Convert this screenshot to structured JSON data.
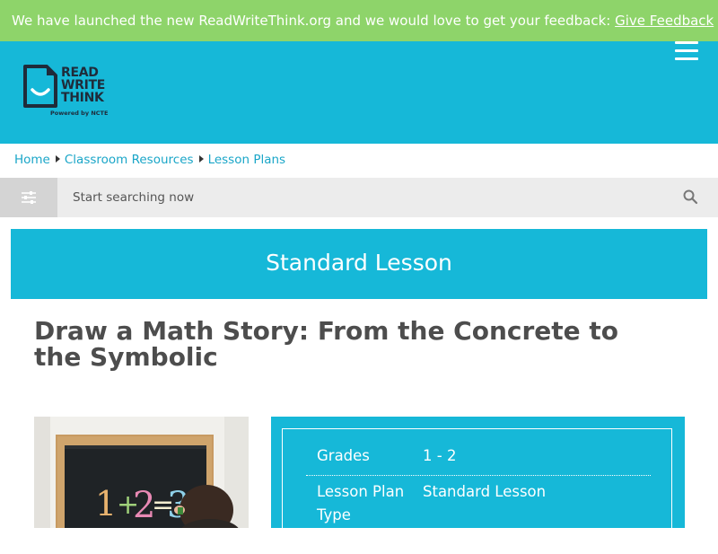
{
  "banner": {
    "message": "We have launched the new ReadWriteThink.org and we would love to get your feedback:",
    "link_label": "Give Feedback"
  },
  "header": {
    "logo": {
      "line1": "READ",
      "line2": "WRITE",
      "line3": "THINK",
      "powered_by": "Powered by NCTE"
    },
    "menu_icon": "hamburger-icon"
  },
  "breadcrumb": [
    "Home",
    "Classroom Resources",
    "Lesson Plans"
  ],
  "search": {
    "placeholder": "Start searching now",
    "filter_icon": "sliders-icon",
    "search_icon": "magnifier-icon"
  },
  "lesson": {
    "type_label": "Standard Lesson",
    "title": "Draw a Math Story: From the Concrete to the Symbolic",
    "image_text": "1+2=3",
    "info": [
      {
        "label": "Grades",
        "value": "1 - 2"
      },
      {
        "label": "Lesson Plan Type",
        "value": "Standard Lesson"
      }
    ]
  },
  "colors": {
    "banner": "#8ed46a",
    "brand": "#16b8d8",
    "link": "#1aa6c8",
    "title": "#4d4d4d"
  }
}
